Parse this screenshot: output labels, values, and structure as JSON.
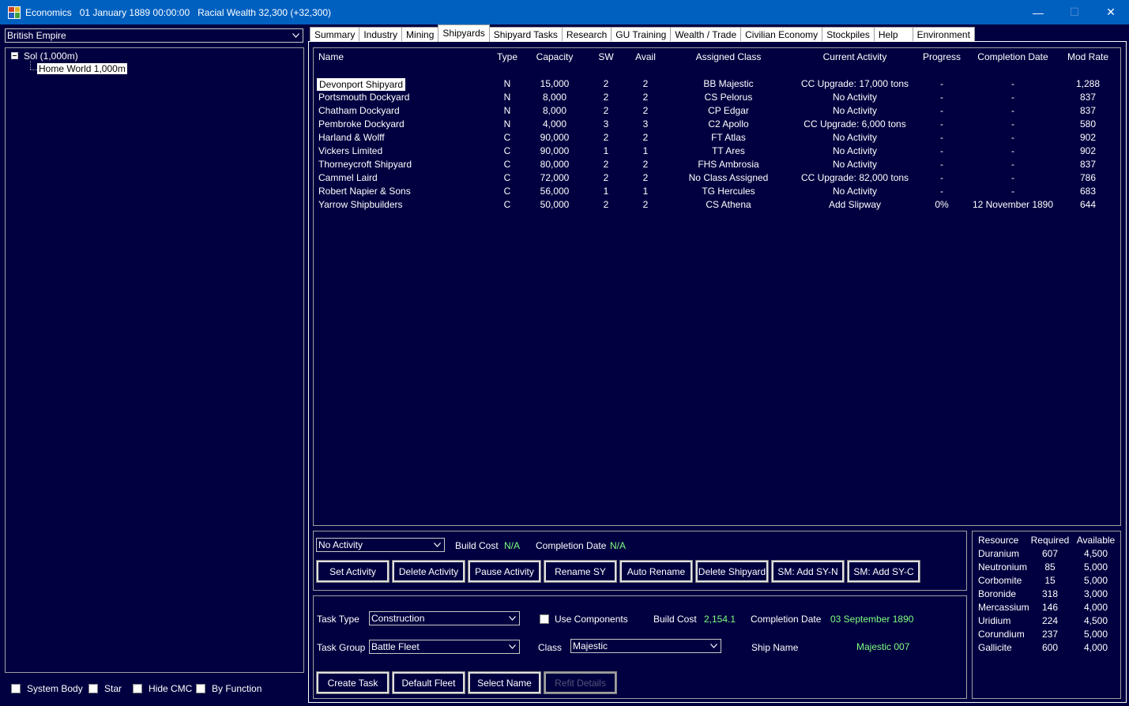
{
  "window": {
    "title": "Economics   01 January 1889 00:00:00   Racial Wealth 32,300 (+32,300)",
    "minimize": "—",
    "maximize": "☐",
    "close": "✕"
  },
  "left": {
    "empire_select": "British Empire",
    "tree": {
      "root": "Sol  (1,000m)",
      "child": "Home World  1,000m"
    },
    "checks": {
      "system_body": "System Body",
      "star": "Star",
      "hide_cmc": "Hide CMC",
      "by_function": "By Function"
    }
  },
  "tabs": [
    "Summary",
    "Industry",
    "Mining",
    "Shipyards",
    "Shipyard Tasks",
    "Research",
    "GU Training",
    "Wealth / Trade",
    "Civilian Economy",
    "Stockpiles",
    "Help",
    "Environment"
  ],
  "table": {
    "headers": {
      "name": "Name",
      "type": "Type",
      "capacity": "Capacity",
      "sw": "SW",
      "avail": "Avail",
      "assigned_class": "Assigned Class",
      "current_activity": "Current Activity",
      "progress": "Progress",
      "completion_date": "Completion Date",
      "mod_rate": "Mod Rate"
    },
    "rows": [
      {
        "name": "Devonport Shipyard",
        "type": "N",
        "capacity": "15,000",
        "sw": "2",
        "avail": "2",
        "assigned_class": "BB Majestic",
        "current_activity": "CC Upgrade: 17,000 tons",
        "progress": "-",
        "completion_date": "-",
        "mod_rate": "1,288"
      },
      {
        "name": "Portsmouth Dockyard",
        "type": "N",
        "capacity": "8,000",
        "sw": "2",
        "avail": "2",
        "assigned_class": "CS Pelorus",
        "current_activity": "No Activity",
        "progress": "-",
        "completion_date": "-",
        "mod_rate": "837"
      },
      {
        "name": "Chatham Dockyard",
        "type": "N",
        "capacity": "8,000",
        "sw": "2",
        "avail": "2",
        "assigned_class": "CP Edgar",
        "current_activity": "No Activity",
        "progress": "-",
        "completion_date": "-",
        "mod_rate": "837"
      },
      {
        "name": "Pembroke Dockyard",
        "type": "N",
        "capacity": "4,000",
        "sw": "3",
        "avail": "3",
        "assigned_class": "C2 Apollo",
        "current_activity": "CC Upgrade: 6,000 tons",
        "progress": "-",
        "completion_date": "-",
        "mod_rate": "580"
      },
      {
        "name": "Harland & Wolff",
        "type": "C",
        "capacity": "90,000",
        "sw": "2",
        "avail": "2",
        "assigned_class": "FT Atlas",
        "current_activity": "No Activity",
        "progress": "-",
        "completion_date": "-",
        "mod_rate": "902"
      },
      {
        "name": "Vickers Limited",
        "type": "C",
        "capacity": "90,000",
        "sw": "1",
        "avail": "1",
        "assigned_class": "TT Ares",
        "current_activity": "No Activity",
        "progress": "-",
        "completion_date": "-",
        "mod_rate": "902"
      },
      {
        "name": "Thorneycroft Shipyard",
        "type": "C",
        "capacity": "80,000",
        "sw": "2",
        "avail": "2",
        "assigned_class": "FHS Ambrosia",
        "current_activity": "No Activity",
        "progress": "-",
        "completion_date": "-",
        "mod_rate": "837"
      },
      {
        "name": "Cammel Laird",
        "type": "C",
        "capacity": "72,000",
        "sw": "2",
        "avail": "2",
        "assigned_class": "No Class Assigned",
        "current_activity": "CC Upgrade: 82,000 tons",
        "progress": "-",
        "completion_date": "-",
        "mod_rate": "786"
      },
      {
        "name": "Robert Napier & Sons",
        "type": "C",
        "capacity": "56,000",
        "sw": "1",
        "avail": "1",
        "assigned_class": "TG Hercules",
        "current_activity": "No Activity",
        "progress": "-",
        "completion_date": "-",
        "mod_rate": "683"
      },
      {
        "name": "Yarrow Shipbuilders",
        "type": "C",
        "capacity": "50,000",
        "sw": "2",
        "avail": "2",
        "assigned_class": "CS Athena",
        "current_activity": "Add Slipway",
        "progress": "0%",
        "completion_date": "12 November 1890",
        "mod_rate": "644"
      }
    ]
  },
  "activity": {
    "select": "No Activity",
    "build_cost_label": "Build Cost",
    "build_cost_value": "N/A",
    "completion_label": "Completion Date",
    "completion_value": "N/A",
    "buttons": [
      "Set Activity",
      "Delete Activity",
      "Pause Activity",
      "Rename SY",
      "Auto Rename",
      "Delete Shipyard",
      "SM: Add SY-N",
      "SM: Add SY-C"
    ]
  },
  "task": {
    "task_type_label": "Task Type",
    "task_type_value": "Construction",
    "use_components": "Use Components",
    "build_cost_label": "Build Cost",
    "build_cost_value": "2,154.1",
    "completion_label": "Completion Date",
    "completion_value": "03 September 1890",
    "task_group_label": "Task Group",
    "task_group_value": "Battle Fleet",
    "class_label": "Class",
    "class_value": "Majestic",
    "ship_name_label": "Ship Name",
    "ship_name_value": "Majestic 007",
    "buttons": [
      "Create Task",
      "Default Fleet",
      "Select Name",
      "Refit Details"
    ]
  },
  "resources": {
    "headers": {
      "resource": "Resource",
      "required": "Required",
      "available": "Available"
    },
    "rows": [
      {
        "resource": "Duranium",
        "required": "607",
        "available": "4,500"
      },
      {
        "resource": "Neutronium",
        "required": "85",
        "available": "5,000"
      },
      {
        "resource": "Corbomite",
        "required": "15",
        "available": "5,000"
      },
      {
        "resource": "Boronide",
        "required": "318",
        "available": "3,000"
      },
      {
        "resource": "Mercassium",
        "required": "146",
        "available": "4,000"
      },
      {
        "resource": "Uridium",
        "required": "224",
        "available": "4,500"
      },
      {
        "resource": "Corundium",
        "required": "237",
        "available": "5,000"
      },
      {
        "resource": "Gallicite",
        "required": "600",
        "available": "4,000"
      }
    ]
  },
  "colors": {
    "background": "#000040",
    "titlebar": "#0060c0",
    "value_green": "#7fff7f"
  }
}
